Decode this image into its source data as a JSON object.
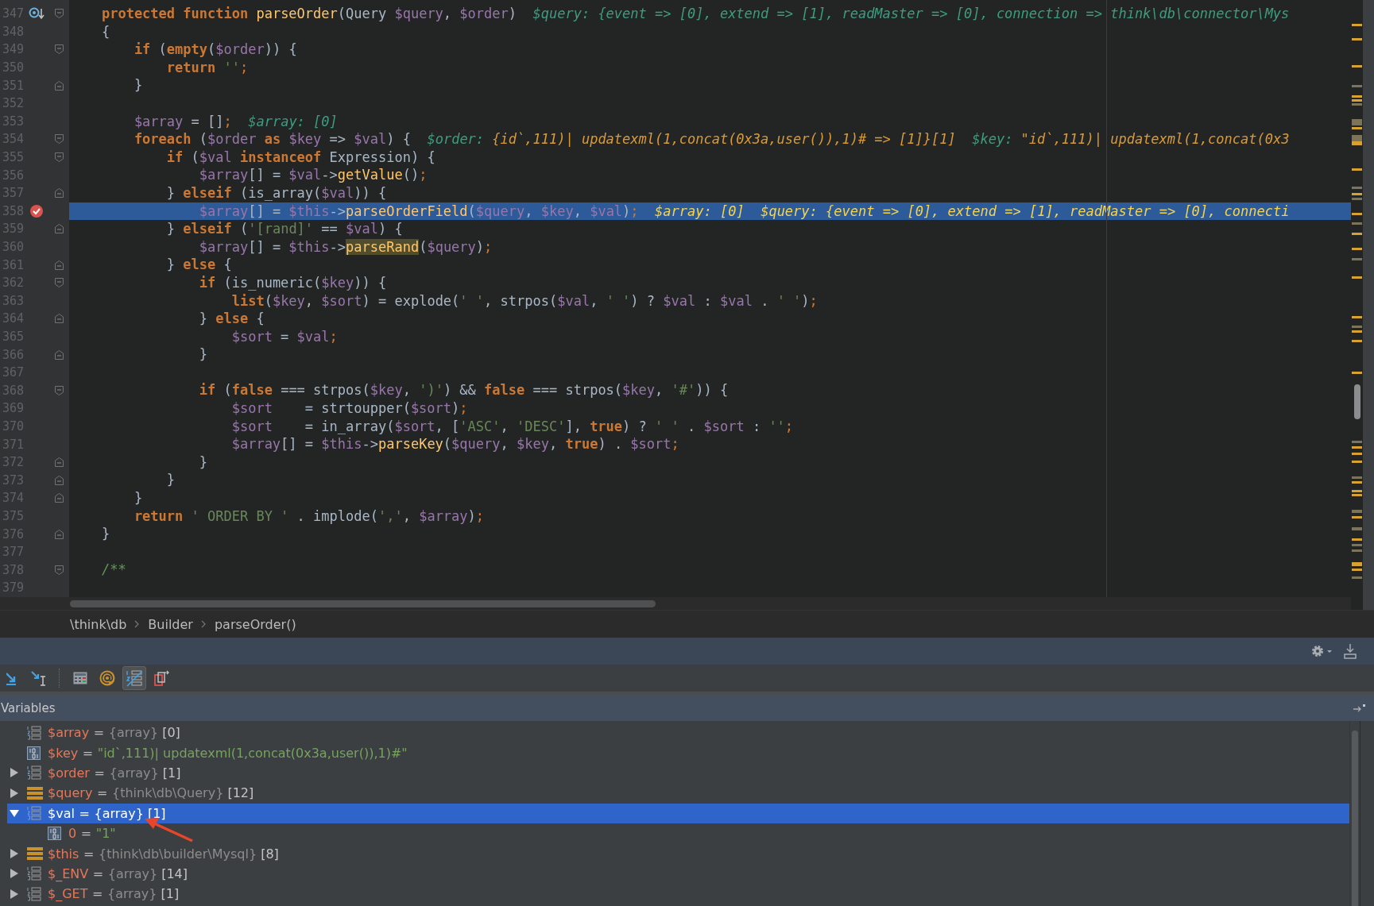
{
  "code_lines": [
    {
      "number": "347",
      "gutter_icon": {
        "kind": "override"
      },
      "fold_marker": {
        "kind": "start"
      },
      "breakpoint": false,
      "current": false,
      "tokens": [
        {
          "kind": "keyword",
          "text": "    protected"
        },
        {
          "kind": "keyword",
          "text": " function"
        },
        {
          "kind": "function",
          "text": " parseOrder"
        },
        {
          "kind": "plain",
          "text": "(Query "
        },
        {
          "kind": "variable",
          "text": "$query"
        },
        {
          "kind": "plain",
          "text": ", "
        },
        {
          "kind": "variable",
          "text": "$order"
        },
        {
          "kind": "plain",
          "text": ")"
        }
      ],
      "hints": [
        {
          "name": "$query:",
          "value": "{event => [0], extend => [1], readMaster => [0], connection => think\\db\\connector\\Mys",
          "changed": false
        }
      ]
    },
    {
      "number": "348",
      "breakpoint": false,
      "current": false,
      "tokens": [
        {
          "kind": "plain",
          "text": "    {"
        }
      ]
    },
    {
      "number": "349",
      "fold_marker": {
        "kind": "start"
      },
      "breakpoint": false,
      "current": false,
      "tokens": [
        {
          "kind": "keyword",
          "text": "        if"
        },
        {
          "kind": "plain",
          "text": " ("
        },
        {
          "kind": "keyword",
          "text": "empty"
        },
        {
          "kind": "plain",
          "text": "("
        },
        {
          "kind": "variable",
          "text": "$order"
        },
        {
          "kind": "plain",
          "text": ")) {"
        }
      ]
    },
    {
      "number": "350",
      "breakpoint": false,
      "current": false,
      "tokens": [
        {
          "kind": "keyword",
          "text": "            return"
        },
        {
          "kind": "string",
          "text": " ''"
        },
        {
          "kind": "punct",
          "text": ";"
        }
      ]
    },
    {
      "number": "351",
      "fold_marker": {
        "kind": "end"
      },
      "breakpoint": false,
      "current": false,
      "tokens": [
        {
          "kind": "plain",
          "text": "        }"
        }
      ]
    },
    {
      "number": "352",
      "breakpoint": false,
      "current": false
    },
    {
      "number": "353",
      "breakpoint": false,
      "current": false,
      "tokens": [
        {
          "kind": "variable",
          "text": "        $array"
        },
        {
          "kind": "plain",
          "text": " = []"
        },
        {
          "kind": "punct",
          "text": ";"
        }
      ],
      "hints": [
        {
          "name": "$array:",
          "value": "[0]",
          "changed": false
        }
      ]
    },
    {
      "number": "354",
      "fold_marker": {
        "kind": "start"
      },
      "breakpoint": false,
      "current": false,
      "tokens": [
        {
          "kind": "keyword",
          "text": "        foreach"
        },
        {
          "kind": "plain",
          "text": " ("
        },
        {
          "kind": "variable",
          "text": "$order"
        },
        {
          "kind": "keyword",
          "text": " as"
        },
        {
          "kind": "variable",
          "text": " $key"
        },
        {
          "kind": "plain",
          "text": " => "
        },
        {
          "kind": "variable",
          "text": "$val"
        },
        {
          "kind": "plain",
          "text": ") {"
        }
      ],
      "hints": [
        {
          "name": "$order:",
          "value": "{id`,111)| updatexml(1,concat(0x3a,user()),1)# => [1]}[1]",
          "changed": true
        },
        {
          "name": "$key:",
          "value": "\"id`,111)| updatexml(1,concat(0x3",
          "changed": true
        }
      ]
    },
    {
      "number": "355",
      "fold_marker": {
        "kind": "start"
      },
      "breakpoint": false,
      "current": false,
      "tokens": [
        {
          "kind": "keyword",
          "text": "            if"
        },
        {
          "kind": "plain",
          "text": " ("
        },
        {
          "kind": "variable",
          "text": "$val"
        },
        {
          "kind": "keyword",
          "text": " instanceof"
        },
        {
          "kind": "plain",
          "text": " Expression) {"
        }
      ]
    },
    {
      "number": "356",
      "breakpoint": false,
      "current": false,
      "tokens": [
        {
          "kind": "variable",
          "text": "                $array"
        },
        {
          "kind": "plain",
          "text": "[] = "
        },
        {
          "kind": "variable",
          "text": "$val"
        },
        {
          "kind": "plain",
          "text": "->"
        },
        {
          "kind": "function",
          "text": "getValue"
        },
        {
          "kind": "plain",
          "text": "()"
        },
        {
          "kind": "punct",
          "text": ";"
        }
      ]
    },
    {
      "number": "357",
      "fold_marker": {
        "kind": "end"
      },
      "breakpoint": false,
      "current": false,
      "tokens": [
        {
          "kind": "plain",
          "text": "            } "
        },
        {
          "kind": "keyword",
          "text": "elseif"
        },
        {
          "kind": "plain",
          "text": " (is_array("
        },
        {
          "kind": "variable",
          "text": "$val"
        },
        {
          "kind": "plain",
          "text": ")) {"
        }
      ]
    },
    {
      "number": "358",
      "breakpoint": true,
      "current": true,
      "tokens": [
        {
          "kind": "variable",
          "text": "                $array"
        },
        {
          "kind": "plain",
          "text": "[] = "
        },
        {
          "kind": "variable",
          "text": "$this"
        },
        {
          "kind": "plain",
          "text": "->"
        },
        {
          "kind": "function",
          "text": "parseOrderField"
        },
        {
          "kind": "plain",
          "text": "("
        },
        {
          "kind": "variable",
          "text": "$query"
        },
        {
          "kind": "plain",
          "text": ", "
        },
        {
          "kind": "variable",
          "text": "$key"
        },
        {
          "kind": "plain",
          "text": ", "
        },
        {
          "kind": "variable",
          "text": "$val"
        },
        {
          "kind": "plain",
          "text": ")"
        },
        {
          "kind": "punct",
          "text": ";"
        }
      ],
      "hints": [
        {
          "name": "$array:",
          "value": "[0]"
        },
        {
          "name": "$query:",
          "value": "{event => [0], extend => [1], readMaster => [0], connecti"
        }
      ]
    },
    {
      "number": "359",
      "fold_marker": {
        "kind": "end"
      },
      "breakpoint": false,
      "current": false,
      "tokens": [
        {
          "kind": "plain",
          "text": "            } "
        },
        {
          "kind": "keyword",
          "text": "elseif"
        },
        {
          "kind": "plain",
          "text": " ("
        },
        {
          "kind": "string",
          "text": "'[rand]'"
        },
        {
          "kind": "plain",
          "text": " == "
        },
        {
          "kind": "variable",
          "text": "$val"
        },
        {
          "kind": "plain",
          "text": ") {"
        }
      ]
    },
    {
      "number": "360",
      "breakpoint": false,
      "current": false,
      "tokens": [
        {
          "kind": "variable",
          "text": "                $array"
        },
        {
          "kind": "plain",
          "text": "[] = "
        },
        {
          "kind": "variable",
          "text": "$this"
        },
        {
          "kind": "plain",
          "text": "->"
        },
        {
          "kind": "match",
          "text": "parseRand"
        },
        {
          "kind": "plain",
          "text": "("
        },
        {
          "kind": "variable",
          "text": "$query"
        },
        {
          "kind": "plain",
          "text": ")"
        },
        {
          "kind": "punct",
          "text": ";"
        }
      ]
    },
    {
      "number": "361",
      "fold_marker": {
        "kind": "end"
      },
      "breakpoint": false,
      "current": false,
      "tokens": [
        {
          "kind": "plain",
          "text": "            } "
        },
        {
          "kind": "keyword",
          "text": "else"
        },
        {
          "kind": "plain",
          "text": " {"
        }
      ]
    },
    {
      "number": "362",
      "fold_marker": {
        "kind": "start"
      },
      "breakpoint": false,
      "current": false,
      "tokens": [
        {
          "kind": "keyword",
          "text": "                if"
        },
        {
          "kind": "plain",
          "text": " (is_numeric("
        },
        {
          "kind": "variable",
          "text": "$key"
        },
        {
          "kind": "plain",
          "text": ")) {"
        }
      ]
    },
    {
      "number": "363",
      "breakpoint": false,
      "current": false,
      "tokens": [
        {
          "kind": "keyword",
          "text": "                    list"
        },
        {
          "kind": "plain",
          "text": "("
        },
        {
          "kind": "variable",
          "text": "$key"
        },
        {
          "kind": "plain",
          "text": ", "
        },
        {
          "kind": "variable",
          "text": "$sort"
        },
        {
          "kind": "plain",
          "text": ") = explode("
        },
        {
          "kind": "string",
          "text": "' '"
        },
        {
          "kind": "plain",
          "text": ", strpos("
        },
        {
          "kind": "variable",
          "text": "$val"
        },
        {
          "kind": "plain",
          "text": ", "
        },
        {
          "kind": "string",
          "text": "' '"
        },
        {
          "kind": "plain",
          "text": ") ? "
        },
        {
          "kind": "variable",
          "text": "$val"
        },
        {
          "kind": "plain",
          "text": " : "
        },
        {
          "kind": "variable",
          "text": "$val"
        },
        {
          "kind": "plain",
          "text": " . "
        },
        {
          "kind": "string",
          "text": "' '"
        },
        {
          "kind": "plain",
          "text": ")"
        },
        {
          "kind": "punct",
          "text": ";"
        }
      ]
    },
    {
      "number": "364",
      "fold_marker": {
        "kind": "end"
      },
      "breakpoint": false,
      "current": false,
      "tokens": [
        {
          "kind": "plain",
          "text": "                } "
        },
        {
          "kind": "keyword",
          "text": "else"
        },
        {
          "kind": "plain",
          "text": " {"
        }
      ]
    },
    {
      "number": "365",
      "breakpoint": false,
      "current": false,
      "tokens": [
        {
          "kind": "variable",
          "text": "                    $sort"
        },
        {
          "kind": "plain",
          "text": " = "
        },
        {
          "kind": "variable",
          "text": "$val"
        },
        {
          "kind": "punct",
          "text": ";"
        }
      ]
    },
    {
      "number": "366",
      "fold_marker": {
        "kind": "end"
      },
      "breakpoint": false,
      "current": false,
      "tokens": [
        {
          "kind": "plain",
          "text": "                }"
        }
      ]
    },
    {
      "number": "367",
      "breakpoint": false,
      "current": false
    },
    {
      "number": "368",
      "fold_marker": {
        "kind": "start"
      },
      "breakpoint": false,
      "current": false,
      "tokens": [
        {
          "kind": "keyword",
          "text": "                if"
        },
        {
          "kind": "plain",
          "text": " ("
        },
        {
          "kind": "keyword",
          "text": "false"
        },
        {
          "kind": "plain",
          "text": " === strpos("
        },
        {
          "kind": "variable",
          "text": "$key"
        },
        {
          "kind": "plain",
          "text": ", "
        },
        {
          "kind": "string",
          "text": "')'"
        },
        {
          "kind": "plain",
          "text": ") && "
        },
        {
          "kind": "keyword",
          "text": "false"
        },
        {
          "kind": "plain",
          "text": " === strpos("
        },
        {
          "kind": "variable",
          "text": "$key"
        },
        {
          "kind": "plain",
          "text": ", "
        },
        {
          "kind": "string",
          "text": "'#'"
        },
        {
          "kind": "plain",
          "text": ")) {"
        }
      ]
    },
    {
      "number": "369",
      "breakpoint": false,
      "current": false,
      "tokens": [
        {
          "kind": "variable",
          "text": "                    $sort"
        },
        {
          "kind": "plain",
          "text": "    = strtoupper("
        },
        {
          "kind": "variable",
          "text": "$sort"
        },
        {
          "kind": "plain",
          "text": ")"
        },
        {
          "kind": "punct",
          "text": ";"
        }
      ]
    },
    {
      "number": "370",
      "breakpoint": false,
      "current": false,
      "tokens": [
        {
          "kind": "variable",
          "text": "                    $sort"
        },
        {
          "kind": "plain",
          "text": "    = in_array("
        },
        {
          "kind": "variable",
          "text": "$sort"
        },
        {
          "kind": "plain",
          "text": ", ["
        },
        {
          "kind": "string",
          "text": "'ASC'"
        },
        {
          "kind": "plain",
          "text": ", "
        },
        {
          "kind": "string",
          "text": "'DESC'"
        },
        {
          "kind": "plain",
          "text": "], "
        },
        {
          "kind": "keyword",
          "text": "true"
        },
        {
          "kind": "plain",
          "text": ") ? "
        },
        {
          "kind": "string",
          "text": "' '"
        },
        {
          "kind": "plain",
          "text": " . "
        },
        {
          "kind": "variable",
          "text": "$sort"
        },
        {
          "kind": "plain",
          "text": " : "
        },
        {
          "kind": "string",
          "text": "''"
        },
        {
          "kind": "punct",
          "text": ";"
        }
      ]
    },
    {
      "number": "371",
      "breakpoint": false,
      "current": false,
      "tokens": [
        {
          "kind": "variable",
          "text": "                    $array"
        },
        {
          "kind": "plain",
          "text": "[] = "
        },
        {
          "kind": "variable",
          "text": "$this"
        },
        {
          "kind": "plain",
          "text": "->"
        },
        {
          "kind": "function",
          "text": "parseKey"
        },
        {
          "kind": "plain",
          "text": "("
        },
        {
          "kind": "variable",
          "text": "$query"
        },
        {
          "kind": "plain",
          "text": ", "
        },
        {
          "kind": "variable",
          "text": "$key"
        },
        {
          "kind": "plain",
          "text": ", "
        },
        {
          "kind": "keyword",
          "text": "true"
        },
        {
          "kind": "plain",
          "text": ") . "
        },
        {
          "kind": "variable",
          "text": "$sort"
        },
        {
          "kind": "punct",
          "text": ";"
        }
      ]
    },
    {
      "number": "372",
      "fold_marker": {
        "kind": "end"
      },
      "breakpoint": false,
      "current": false,
      "tokens": [
        {
          "kind": "plain",
          "text": "                }"
        }
      ]
    },
    {
      "number": "373",
      "fold_marker": {
        "kind": "end"
      },
      "breakpoint": false,
      "current": false,
      "tokens": [
        {
          "kind": "plain",
          "text": "            }"
        }
      ]
    },
    {
      "number": "374",
      "fold_marker": {
        "kind": "end"
      },
      "breakpoint": false,
      "current": false,
      "tokens": [
        {
          "kind": "plain",
          "text": "        }"
        }
      ]
    },
    {
      "number": "375",
      "breakpoint": false,
      "current": false,
      "tokens": [
        {
          "kind": "keyword",
          "text": "        return"
        },
        {
          "kind": "string",
          "text": " ' ORDER BY '"
        },
        {
          "kind": "plain",
          "text": " . implode("
        },
        {
          "kind": "string",
          "text": "','"
        },
        {
          "kind": "plain",
          "text": ", "
        },
        {
          "kind": "variable",
          "text": "$array"
        },
        {
          "kind": "plain",
          "text": ")"
        },
        {
          "kind": "punct",
          "text": ";"
        }
      ]
    },
    {
      "number": "376",
      "fold_marker": {
        "kind": "end"
      },
      "breakpoint": false,
      "current": false,
      "tokens": [
        {
          "kind": "plain",
          "text": "    }"
        }
      ]
    },
    {
      "number": "377",
      "breakpoint": false,
      "current": false
    },
    {
      "number": "378",
      "fold_marker": {
        "kind": "start"
      },
      "breakpoint": false,
      "current": false,
      "tokens": [
        {
          "kind": "comment",
          "text": "    /**"
        }
      ]
    },
    {
      "number": "379",
      "breakpoint": false,
      "current": false
    }
  ],
  "breadcrumbs": [
    "\\think\\db",
    "Builder",
    "parseOrder()"
  ],
  "toolbar": [
    {
      "kind": "step-out",
      "selected": false
    },
    {
      "kind": "run-to-cursor",
      "selected": false
    },
    {
      "kind": "evaluate",
      "selected": false
    },
    {
      "kind": "watch",
      "selected": false
    },
    {
      "kind": "values-toggle",
      "selected": true
    },
    {
      "kind": "restore",
      "selected": false
    }
  ],
  "variables_title": "Variables",
  "variables": [
    {
      "name": "$array",
      "operator": "=",
      "type": "{array}",
      "count": "[0]",
      "kind": "array",
      "selected": false
    },
    {
      "name": "$key",
      "operator": "=",
      "value": "\"id`,111)| updatexml(1,concat(0x3a,user()),1)#\"",
      "kind": "scalar",
      "selected": false
    },
    {
      "name": "$order",
      "operator": "=",
      "type": "{array}",
      "count": "[1]",
      "kind": "array",
      "expanded": false,
      "selected": false
    },
    {
      "name": "$query",
      "operator": "=",
      "type": "{think\\db\\Query}",
      "count": "[12]",
      "kind": "object",
      "expanded": false,
      "selected": false
    },
    {
      "name": "$val",
      "operator": "=",
      "type": "{array}",
      "count": "[1]",
      "kind": "array",
      "expanded": true,
      "selected": true,
      "children": [
        {
          "name": "0",
          "operator": "=",
          "value": "\"1\"",
          "kind": "scalar",
          "selected": false
        }
      ]
    },
    {
      "name": "$this",
      "operator": "=",
      "type": "{think\\db\\builder\\Mysql}",
      "count": "[8]",
      "kind": "object",
      "expanded": false,
      "selected": false
    },
    {
      "name": "$_ENV",
      "operator": "=",
      "type": "{array}",
      "count": "[14]",
      "kind": "array",
      "expanded": false,
      "selected": false
    },
    {
      "name": "$_GET",
      "operator": "=",
      "type": "{array}",
      "count": "[1]",
      "kind": "array",
      "expanded": false,
      "selected": false
    }
  ]
}
